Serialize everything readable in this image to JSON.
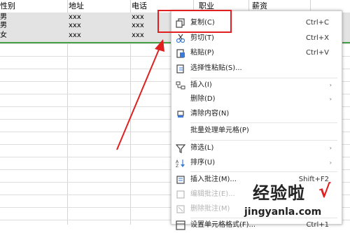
{
  "sheet": {
    "headers": [
      "性别",
      "地址",
      "电话",
      "职业",
      "薪资"
    ],
    "rows": [
      [
        "男",
        "xxx",
        "xxx"
      ],
      [
        "男",
        "xxx",
        "xxx"
      ],
      [
        "女",
        "xxx",
        "xxx"
      ]
    ]
  },
  "context_menu": {
    "items": [
      {
        "label": "复制(C)",
        "shortcut": "Ctrl+C",
        "icon": "copy-icon"
      },
      {
        "label": "剪切(T)",
        "shortcut": "Ctrl+X",
        "icon": "scissors-icon"
      },
      {
        "label": "粘贴(P)",
        "shortcut": "Ctrl+V",
        "icon": "paste-icon"
      },
      {
        "label": "选择性粘贴(S)...",
        "shortcut": "",
        "icon": "paste-special-icon"
      },
      {
        "label": "插入(I)",
        "shortcut": "",
        "icon": "insert-icon"
      },
      {
        "label": "删除(D)",
        "shortcut": "",
        "icon": "delete-icon"
      },
      {
        "label": "清除内容(N)",
        "shortcut": "",
        "icon": "eraser-icon"
      },
      {
        "label": "批量处理单元格(P)",
        "shortcut": "",
        "icon": ""
      },
      {
        "label": "筛选(L)",
        "shortcut": "",
        "icon": "filter-icon"
      },
      {
        "label": "排序(U)",
        "shortcut": "",
        "icon": "sort-icon"
      },
      {
        "label": "插入批注(M)...",
        "shortcut": "Shift+F2",
        "icon": "comment-add-icon"
      },
      {
        "label": "编辑批注(E)...",
        "shortcut": "",
        "icon": "comment-edit-icon"
      },
      {
        "label": "删除批注(M)",
        "shortcut": "",
        "icon": "comment-delete-icon"
      },
      {
        "label": "设置单元格格式(F)...",
        "shortcut": "Ctrl+1",
        "icon": "format-cells-icon"
      }
    ],
    "submenu_indicator": "›"
  },
  "watermark": {
    "text_cn": "经验啦",
    "check": "√",
    "text_en": "jingyanla.com"
  },
  "colors": {
    "highlight": "#e02020",
    "selection_border": "#46a046",
    "selected_rows": "#e3e3e3"
  }
}
